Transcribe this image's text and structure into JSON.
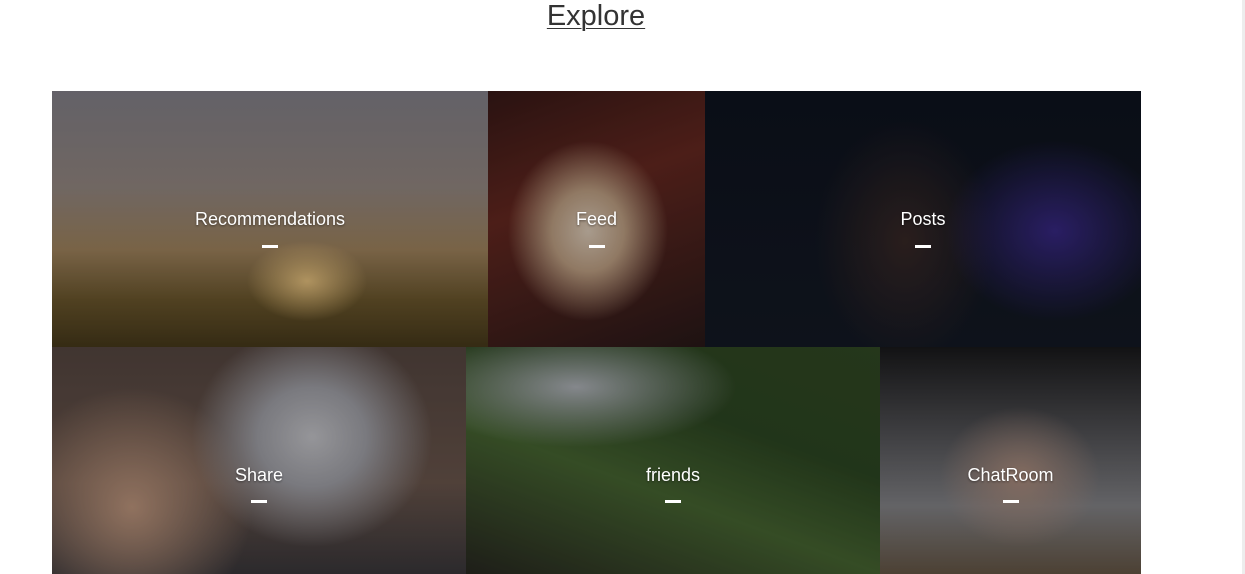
{
  "page": {
    "title": "Explore"
  },
  "tiles": [
    {
      "label": "Recommendations"
    },
    {
      "label": "Feed"
    },
    {
      "label": "Posts"
    },
    {
      "label": "Share"
    },
    {
      "label": "friends"
    },
    {
      "label": "ChatRoom"
    }
  ],
  "colors": {
    "label_text": "#ffffff",
    "title_text": "#333333",
    "tile_overlay": "rgba(0,0,0,0.28)"
  }
}
